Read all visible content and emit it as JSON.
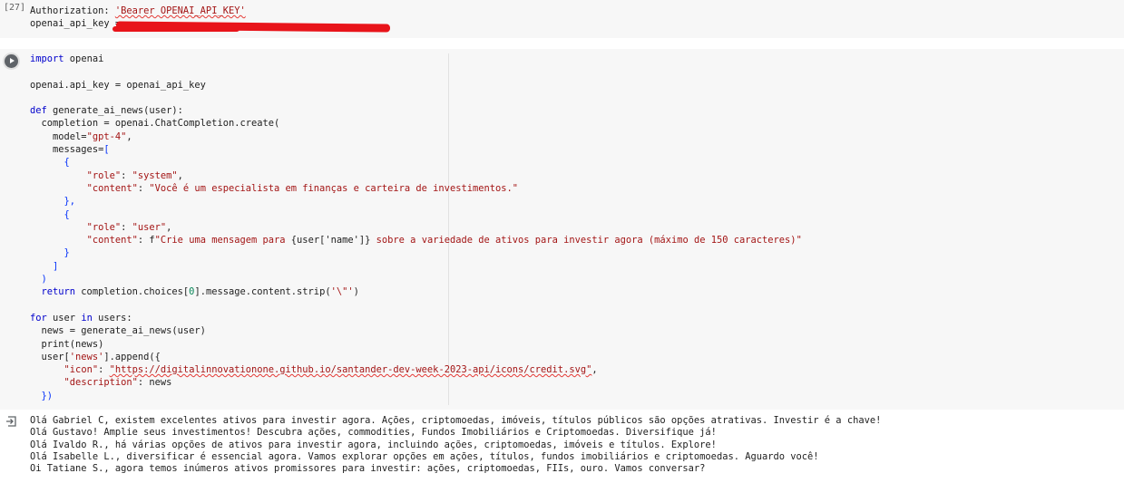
{
  "cell1": {
    "execution_count": "[27]",
    "lines": [
      "Authorization: ",
      "'Bearer OPENAI_API_KEY'",
      "openai_api_key = "
    ]
  },
  "cell2": {
    "line_import": [
      "import",
      " openai"
    ],
    "line_key": "openai.api_key = openai_api_key",
    "line_def": [
      "def",
      " generate_ai_news(user):"
    ],
    "line_completion": "  completion = openai.ChatCompletion.create(",
    "line_model": [
      "    model=",
      "\"gpt-4\"",
      ","
    ],
    "line_messages": [
      "    messages=",
      "["
    ],
    "line_open1": "      {",
    "line_role_system": [
      "          ",
      "\"role\"",
      ": ",
      "\"system\"",
      ","
    ],
    "line_content_system": [
      "          ",
      "\"content\"",
      ": ",
      "\"Você é um especialista em finanças e carteira de investimentos.\""
    ],
    "line_close1": "      },",
    "line_open2": "      {",
    "line_role_user": [
      "          ",
      "\"role\"",
      ": ",
      "\"user\"",
      ","
    ],
    "line_content_user": [
      "          ",
      "\"content\"",
      ": f",
      "\"Crie uma mensagem para ",
      "{user['name']}",
      " sobre a variedade de ativos para investir agora (máximo de 150 caracteres)\""
    ],
    "line_close2": "      }",
    "line_close_list": "    ]",
    "line_close_paren": "  )",
    "line_return": [
      "  return",
      " completion.choices[",
      "0",
      "].message.content.strip(",
      "'\\\"'",
      ")"
    ],
    "line_for": [
      "for",
      " user ",
      "in",
      " users:"
    ],
    "line_news": "  news = generate_ai_news(user)",
    "line_print": "  print(news)",
    "line_append": [
      "  user[",
      "'news'",
      "].append({"
    ],
    "line_icon": [
      "      ",
      "\"icon\"",
      ": ",
      "\"https://digitalinnovationone.github.io/santander-dev-week-2023-api/icons/credit.svg\"",
      ","
    ],
    "line_description": [
      "      ",
      "\"description\"",
      ": news"
    ],
    "line_end": "  })"
  },
  "output": {
    "lines": [
      "Olá Gabriel C, existem excelentes ativos para investir agora. Ações, criptomoedas, imóveis, títulos públicos são opções atrativas. Investir é a chave!",
      "Olá Gustavo! Amplie seus investimentos! Descubra ações, commodities, Fundos Imobiliários e Criptomoedas. Diversifique já!",
      "Olá Ivaldo R., há várias opções de ativos para investir agora, incluindo ações, criptomoedas, imóveis e títulos. Explore!",
      "Olá Isabelle L., diversificar é essencial agora. Vamos explorar opções em ações, títulos, fundos imobiliários e criptomoedas. Aguardo você!",
      "Oi Tatiane S., agora temos inúmeros ativos promissores para investir: ações, criptomoedas, FIIs, ouro. Vamos conversar?"
    ]
  },
  "colors": {
    "keyword": "#0000cc",
    "string": "#a31515",
    "number": "#098658",
    "redaction": "#e8141a"
  }
}
